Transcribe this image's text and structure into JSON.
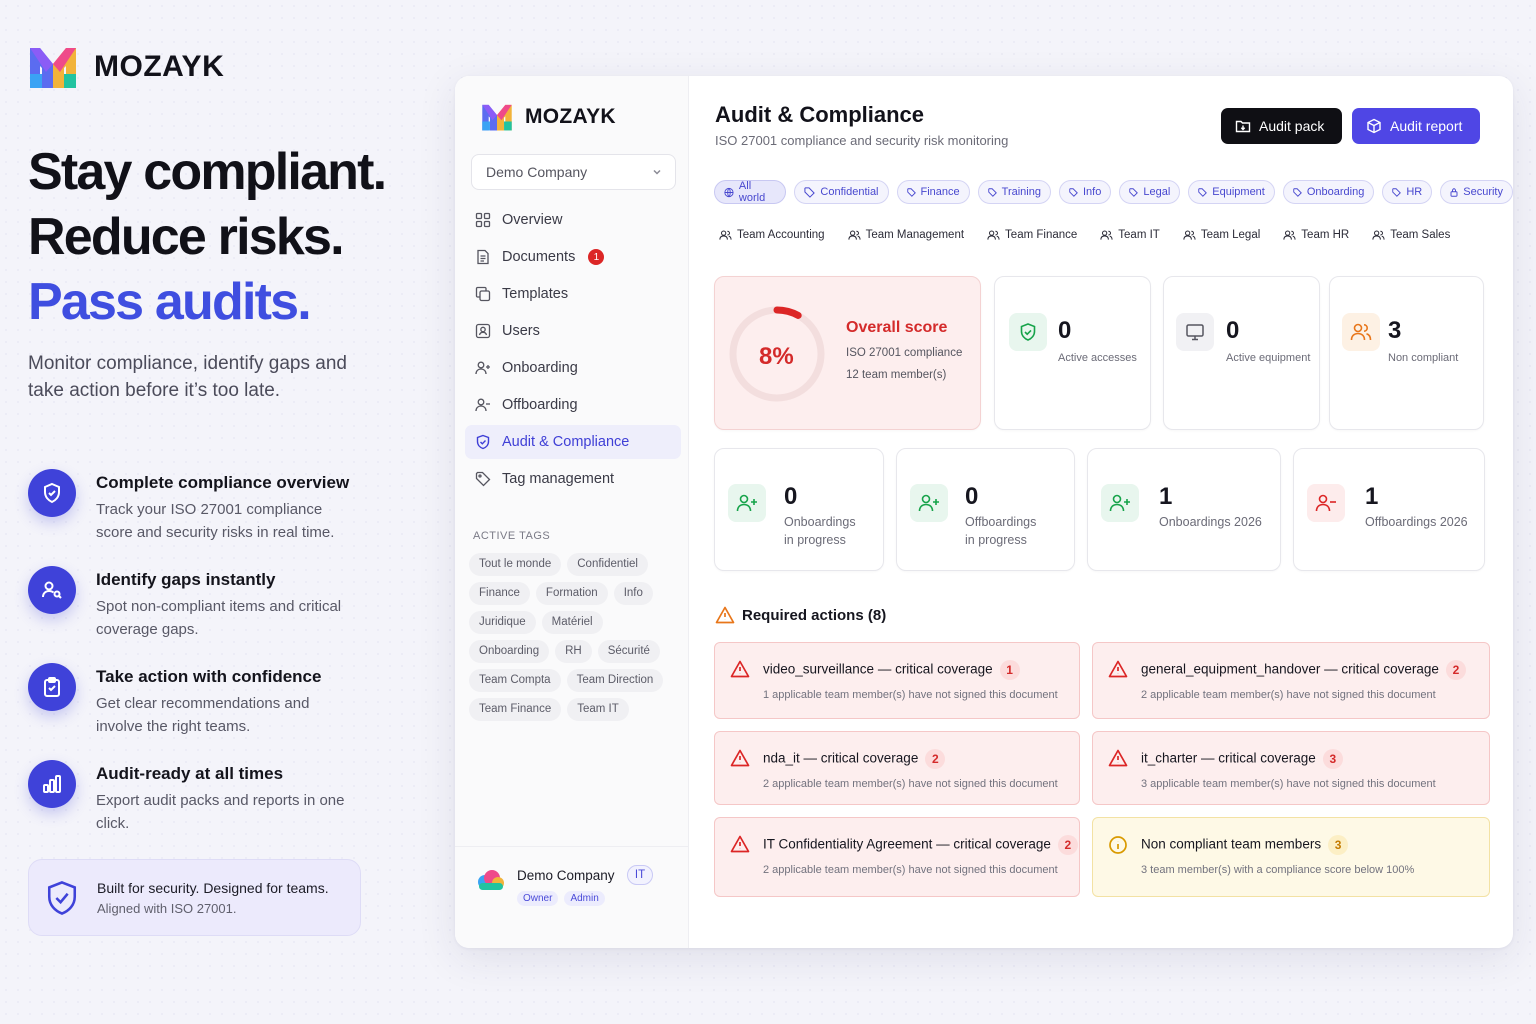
{
  "hero": {
    "brand": "MOZAYK",
    "headline": [
      "Stay compliant.",
      "Reduce risks.",
      "Pass audits."
    ],
    "subtext": "Monitor compliance, identify gaps and take action before it’s too late.",
    "features": [
      {
        "title": "Complete compliance overview",
        "desc": "Track your ISO 27001 compliance score and security risks in real time.",
        "icon": "shield-check-icon"
      },
      {
        "title": "Identify gaps instantly",
        "desc": "Spot non-compliant items and critical coverage gaps.",
        "icon": "users-search-icon"
      },
      {
        "title": "Take action with confidence",
        "desc": "Get clear recommendations and involve the right teams.",
        "icon": "clipboard-check-icon"
      },
      {
        "title": "Audit-ready at all times",
        "desc": "Export audit packs and reports in one click.",
        "icon": "bar-chart-icon"
      }
    ],
    "callout": {
      "title": "Built for security. Designed for teams.",
      "sub": "Aligned with ISO 27001."
    }
  },
  "sidebar": {
    "brand": "MOZAYK",
    "company_select": "Demo Company",
    "nav": [
      {
        "label": "Overview",
        "icon": "grid-icon"
      },
      {
        "label": "Documents",
        "icon": "document-icon",
        "badge": "1"
      },
      {
        "label": "Templates",
        "icon": "copy-icon"
      },
      {
        "label": "Users",
        "icon": "user-card-icon"
      },
      {
        "label": "Onboarding",
        "icon": "user-plus-icon"
      },
      {
        "label": "Offboarding",
        "icon": "user-minus-icon"
      },
      {
        "label": "Audit & Compliance",
        "icon": "shield-icon",
        "active": true
      },
      {
        "label": "Tag management",
        "icon": "tag-icon"
      }
    ],
    "tags_title": "ACTIVE TAGS",
    "tags": [
      "Tout le monde",
      "Confidentiel",
      "Finance",
      "Formation",
      "Info",
      "Juridique",
      "Matériel",
      "Onboarding",
      "RH",
      "Sécurité",
      "Team Compta",
      "Team Direction",
      "Team Finance",
      "Team IT"
    ],
    "footer": {
      "company": "Demo Company",
      "initials": "IT",
      "roles": [
        "Owner",
        "Admin"
      ]
    }
  },
  "main": {
    "title": "Audit & Compliance",
    "subtitle": "ISO 27001 compliance and security risk monitoring",
    "buttons": {
      "audit_pack": "Audit pack",
      "audit_report": "Audit report"
    },
    "filters": [
      "All world",
      "Confidential",
      "Finance",
      "Training",
      "Info",
      "Legal",
      "Equipment",
      "Onboarding",
      "HR",
      "Security"
    ],
    "teams": [
      "Team Accounting",
      "Team Management",
      "Team Finance",
      "Team IT",
      "Team Legal",
      "Team HR",
      "Team Sales"
    ],
    "score": {
      "pct": "8%",
      "value": 8,
      "title": "Overall score",
      "line1": "ISO 27001 compliance",
      "line2": "12 team member(s)"
    },
    "stats_top": [
      {
        "num": "0",
        "label": "Active accesses",
        "icon": "shield-check-icon"
      },
      {
        "num": "0",
        "label": "Active equipment",
        "icon": "monitor-icon"
      },
      {
        "num": "3",
        "label": "Non compliant",
        "icon": "users-icon"
      }
    ],
    "stats_bottom": [
      {
        "num": "0",
        "label1": "Onboardings",
        "label2": "in progress",
        "icon": "user-plus-icon"
      },
      {
        "num": "0",
        "label1": "Offboardings",
        "label2": "in progress",
        "icon": "user-plus-icon"
      },
      {
        "num": "1",
        "label1": "Onboardings 2026",
        "label2": "",
        "icon": "user-plus-icon"
      },
      {
        "num": "1",
        "label1": "Offboardings 2026",
        "label2": "",
        "icon": "user-minus-icon"
      }
    ],
    "required_actions": {
      "title": "Required actions (8)",
      "items": [
        {
          "title": "video_surveillance — critical coverage",
          "count": "1",
          "desc": "1 applicable team member(s) have not signed this document"
        },
        {
          "title": "general_equipment_handover — critical coverage",
          "count": "2",
          "desc": "2 applicable team member(s) have not signed this document"
        },
        {
          "title": "nda_it — critical coverage",
          "count": "2",
          "desc": "2 applicable team member(s) have not signed this document"
        },
        {
          "title": "it_charter — critical coverage",
          "count": "3",
          "desc": "3 applicable team member(s) have not signed this document"
        },
        {
          "title": "IT Confidentiality Agreement — critical coverage",
          "count": "2",
          "desc": "2 applicable team member(s) have not signed this document"
        },
        {
          "title": "Non compliant team members",
          "count": "3",
          "desc": "3 team member(s) with a compliance score below 100%"
        }
      ]
    }
  },
  "colors": {
    "primary": "#4f46e5",
    "danger": "#d42a2a",
    "warning": "#c47b00",
    "success": "#16a34a"
  }
}
